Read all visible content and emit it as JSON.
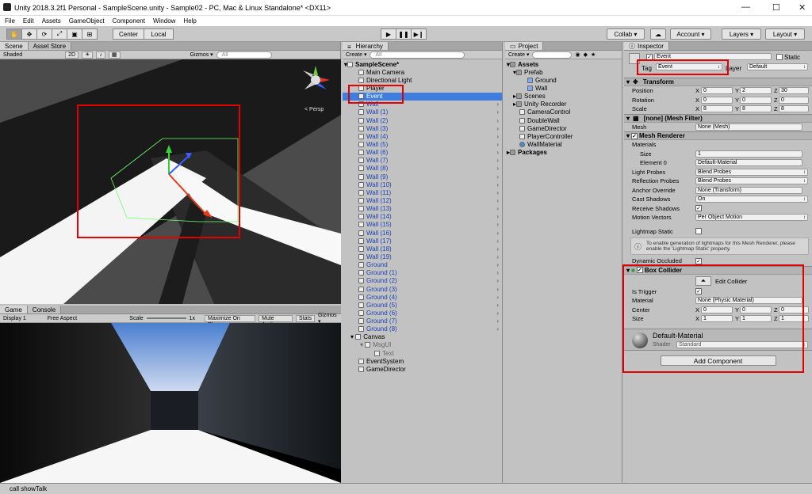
{
  "window": {
    "title": "Unity 2018.3.2f1 Personal - SampleScene.unity - Sample02 - PC, Mac & Linux Standalone* <DX11>",
    "min": "—",
    "max": "☐",
    "close": "✕"
  },
  "menu": [
    "File",
    "Edit",
    "Assets",
    "GameObject",
    "Component",
    "Window",
    "Help"
  ],
  "toolbar": {
    "center": "Center",
    "local": "Local",
    "collab": "Collab ▾",
    "account": "Account ▾",
    "layers": "Layers ▾",
    "layout": "Layout ▾"
  },
  "scene": {
    "tab1": "Scene",
    "tab2": "Asset Store",
    "shaded": "Shaded",
    "mode2d": "2D",
    "gizmos": "Gizmos ▾",
    "search": "All",
    "persp": "< Persp"
  },
  "game": {
    "tab1": "Game",
    "tab2": "Console",
    "display": "Display 1",
    "aspect": "Free Aspect",
    "scale": "Scale",
    "scale_val": "1x",
    "max_on_play": "Maximize On Play",
    "mute": "Mute Audio",
    "stats": "Stats",
    "gizmos": "Gizmos ▾"
  },
  "hierarchy": {
    "tab": "Hierarchy",
    "create": "Create ▾",
    "search": "All",
    "scene": "SampleScene*",
    "items": [
      "Main Camera",
      "Directional Light",
      "Player",
      "Event",
      "Wall",
      "Wall (1)",
      "Wall (2)",
      "Wall (3)",
      "Wall (4)",
      "Wall (5)",
      "Wall (6)",
      "Wall (7)",
      "Wall (8)",
      "Wall (9)",
      "Wall (10)",
      "Wall (11)",
      "Wall (12)",
      "Wall (13)",
      "Wall (14)",
      "Wall (15)",
      "Wall (16)",
      "Wall (17)",
      "Wall (18)",
      "Wall (19)",
      "Ground",
      "Ground (1)",
      "Ground (2)",
      "Ground (3)",
      "Ground (4)",
      "Ground (5)",
      "Ground (6)",
      "Ground (7)",
      "Ground (8)",
      "Canvas",
      "MsgUI",
      "Text",
      "EventSystem",
      "GameDirector"
    ]
  },
  "project": {
    "tab": "Project",
    "create": "Create ▾",
    "items": [
      "Assets",
      "Prefab",
      "Ground",
      "Wall",
      "Scenes",
      "Unity Recorder",
      "CameraControl",
      "DoubleWall",
      "GameDirector",
      "PlayerController",
      "WallMaterial",
      "Packages"
    ]
  },
  "inspector": {
    "tab": "Inspector",
    "name": "Event",
    "static": "Static",
    "tag_label": "Tag",
    "tag": "Event",
    "layer_label": "Layer",
    "layer": "Default",
    "transform": {
      "title": "Transform",
      "rows": [
        {
          "label": "Position",
          "x": "0",
          "y": "2",
          "z": "30"
        },
        {
          "label": "Rotation",
          "x": "0",
          "y": "0",
          "z": "0"
        },
        {
          "label": "Scale",
          "x": "8",
          "y": "8",
          "z": "8"
        }
      ]
    },
    "mesh_filter": {
      "title": "[none] (Mesh Filter)",
      "mesh_label": "Mesh",
      "mesh": "None (Mesh)"
    },
    "mesh_renderer": {
      "title": "Mesh Renderer",
      "materials": "Materials",
      "size_label": "Size",
      "size": "1",
      "element0_label": "Element 0",
      "element0": "Default-Material",
      "light_probes_label": "Light Probes",
      "light_probes": "Blend Probes",
      "reflection_label": "Reflection Probes",
      "reflection": "Blend Probes",
      "anchor_label": "Anchor Override",
      "anchor": "None (Transform)",
      "cast_label": "Cast Shadows",
      "cast": "On",
      "receive_label": "Receive Shadows",
      "motion_label": "Motion Vectors",
      "motion": "Per Object Motion",
      "lightmap_label": "Lightmap Static",
      "info": "To enable generation of lightmaps for this Mesh Renderer, please enable the 'Lightmap Static' property.",
      "dyn_label": "Dynamic Occluded"
    },
    "box_collider": {
      "title": "Box Collider",
      "edit": "Edit Collider",
      "trigger_label": "Is Trigger",
      "material_label": "Material",
      "material": "None (Physic Material)",
      "center_label": "Center",
      "center": {
        "x": "0",
        "y": "0",
        "z": "0"
      },
      "size_label": "Size",
      "size": {
        "x": "1",
        "y": "1",
        "z": "1"
      }
    },
    "material": {
      "name": "Default-Material",
      "shader_label": "Shader",
      "shader": "Standard"
    },
    "add_component": "Add Component"
  },
  "status": "call showTalk",
  "colors": {
    "selection": "#3d7ee0",
    "highlight": "#e00000",
    "prefab_text": "#1e44b5"
  }
}
